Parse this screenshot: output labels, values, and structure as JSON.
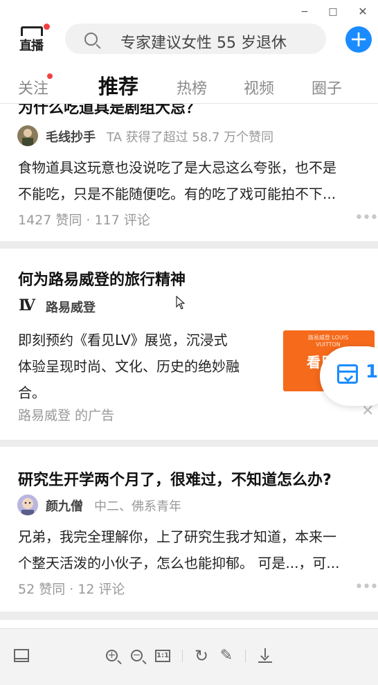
{
  "window": {
    "minimize": "−",
    "maximize": "□",
    "close": "✕"
  },
  "topbar": {
    "live_label": "直播",
    "search_text": "专家建议女性 55 岁退休",
    "add_label": "+"
  },
  "tabs": [
    {
      "label": "关注",
      "has_dot": true
    },
    {
      "label": "推荐",
      "active": true
    },
    {
      "label": "热榜"
    },
    {
      "label": "视频"
    },
    {
      "label": "圈子"
    }
  ],
  "feed": [
    {
      "title": "为什么吃道具是剧组大忌？",
      "author": "毛线抄手",
      "author_desc": "TA 获得了超过 58.7 万个赞同",
      "excerpt_1": "食物道具这玩意也没说吃了是大忌这么夸张，也不是",
      "excerpt_2": "不能吃，只是不能随便吃。有的吃了戏可能拍不下...",
      "meta": "1427 赞同 · 117 评论",
      "more": "•••"
    },
    {
      "title": "何为路易威登的旅行精神",
      "brand_logo": "LV",
      "author": "路易威登",
      "excerpt_1": "即刻预约《看见LV》展览，沉浸式",
      "excerpt_2": "体验呈现时尚、文化、历史的绝妙融",
      "excerpt_3": "合。",
      "meta": "路易威登 的广告",
      "image_caption_top": "路易威登 LOUIS VUITTON",
      "image_caption_main": "看见LV",
      "close": "✕"
    },
    {
      "title": "研究生开学两个月了，很难过，不知道怎么办?",
      "author": "颜九僧",
      "author_desc": "中二、佛系青年",
      "excerpt_1": "兄弟，我完全理解你，上了研究生我才知道，本来一",
      "excerpt_2": "个整天活泼的小伙子，怎么也能抑郁。 可是...，可...",
      "meta": "52 赞同 · 12 评论",
      "more": "•••"
    }
  ],
  "favorite": {
    "count": "1"
  },
  "toolbar": {
    "ratio_label": "1:1",
    "zoom_in": "+",
    "zoom_out": "−",
    "rotate": "↻",
    "edit": "✎"
  },
  "colors": {
    "accent": "#1a8cff",
    "badge": "#f04142",
    "ad_orange": "#f56a1b"
  }
}
